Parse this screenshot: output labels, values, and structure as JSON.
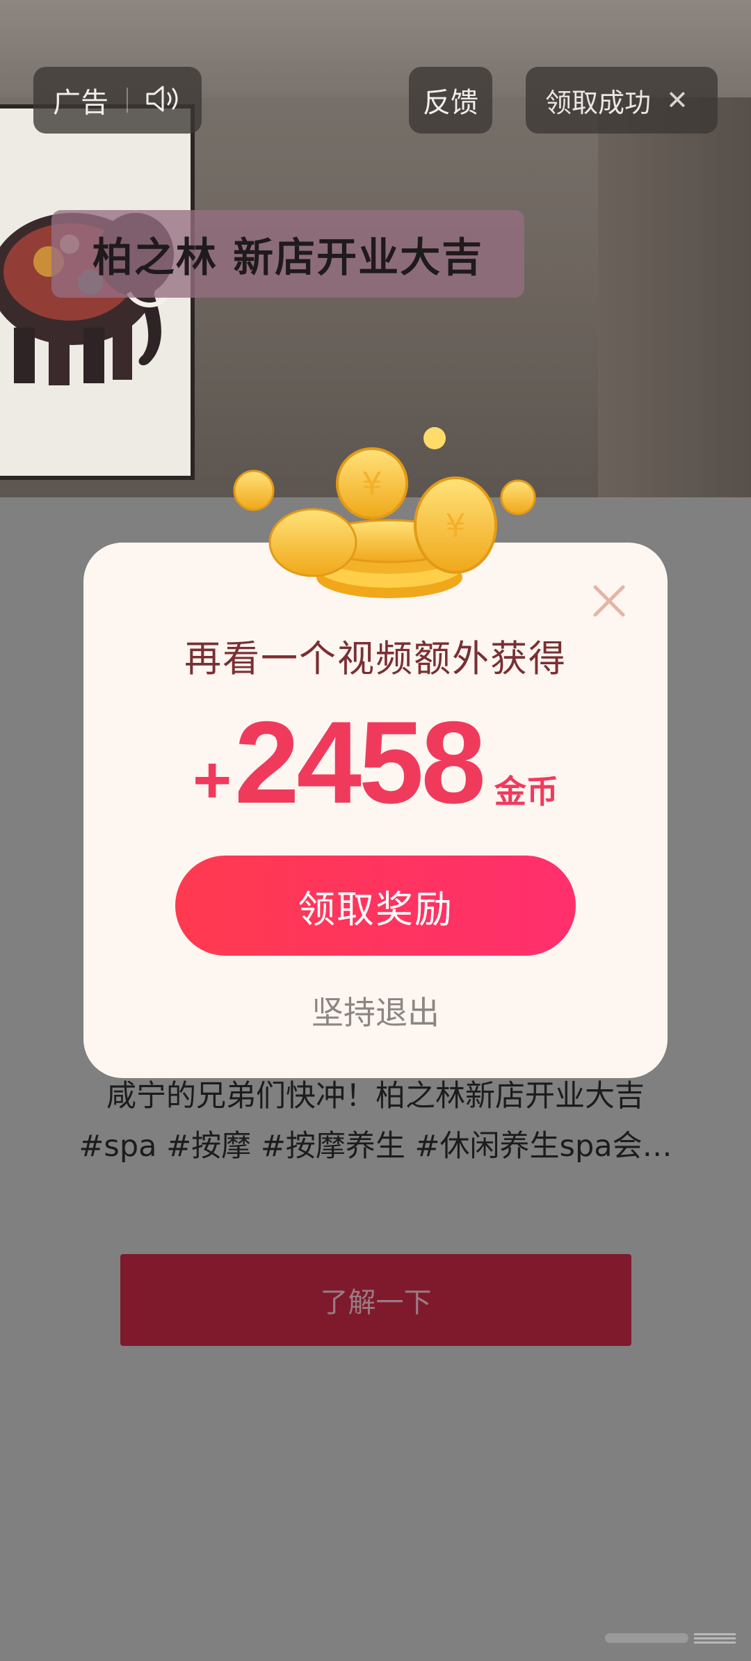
{
  "ad_bar": {
    "ad_label": "广告",
    "feedback_label": "反馈",
    "claimed_label": "领取成功"
  },
  "video": {
    "banner_text": "柏之林 新店开业大吉"
  },
  "dialog": {
    "headline": "再看一个视频额外获得",
    "amount_sign": "+",
    "amount_value": "2458",
    "amount_unit": "金币",
    "claim_button": "领取奖励",
    "quit_link": "坚持退出"
  },
  "ad_info": {
    "description_line1": "咸宁的兄弟们快冲！柏之林新店开业大吉",
    "description_line2": "#spa #按摩 #按摩养生 #休闲养生spa会…",
    "learn_more_button": "了解一下"
  },
  "colors": {
    "accent_red": "#f03a5c",
    "headline_brown": "#7a2f33",
    "learn_button_bg": "#7e1a2c"
  },
  "icons": [
    "speaker-icon",
    "close-icon",
    "coins-illustration",
    "dialog-close-icon"
  ]
}
